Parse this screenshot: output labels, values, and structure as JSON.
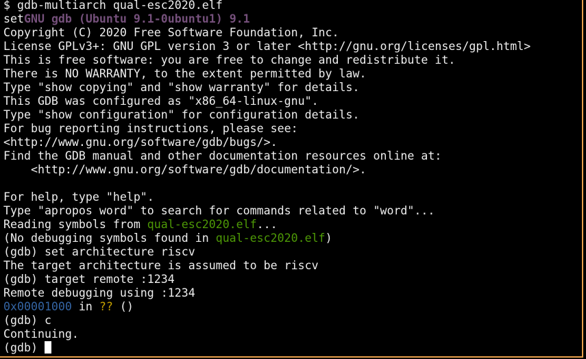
{
  "colors": {
    "background": "#000000",
    "foreground": "#eeeeee",
    "banner": "#75507b",
    "filename": "#4e9a06",
    "address": "#3465a4",
    "unknown_symbol": "#c4a000",
    "window_border": "#e8a04c"
  },
  "terminal": {
    "command_line": "$ gdb-multiarch qual-esc2020.elf",
    "banner_prefix": "set",
    "banner": "GNU gdb (Ubuntu 9.1-0ubuntu1) 9.1",
    "copyright": "Copyright (C) 2020 Free Software Foundation, Inc.",
    "license": "License GPLv3+: GNU GPL version 3 or later <http://gnu.org/licenses/gpl.html>",
    "free_software": "This is free software: you are free to change and redistribute it.",
    "no_warranty": "There is NO WARRANTY, to the extent permitted by law.",
    "show_copying": "Type \"show copying\" and \"show warranty\" for details.",
    "configured": "This GDB was configured as \"x86_64-linux-gnu\".",
    "show_configuration": "Type \"show configuration\" for configuration details.",
    "bug_reporting": "For bug reporting instructions, please see:",
    "bugs_url": "<http://www.gnu.org/software/gdb/bugs/>.",
    "manual": "Find the GDB manual and other documentation resources online at:",
    "documentation_url": "    <http://www.gnu.org/software/gdb/documentation/>.",
    "blank": "",
    "help": "For help, type \"help\".",
    "apropos": "Type \"apropos word\" to search for commands related to \"word\"...",
    "reading_prefix": "Reading symbols from ",
    "reading_file": "qual-esc2020.elf",
    "reading_suffix": "...",
    "no_symbols_prefix": "(No debugging symbols found in ",
    "no_symbols_file": "qual-esc2020.elf",
    "no_symbols_suffix": ")",
    "set_arch_cmd": "(gdb) set architecture riscv",
    "arch_assumed": "The target architecture is assumed to be riscv",
    "target_remote_cmd": "(gdb) target remote :1234",
    "remote_debugging": "Remote debugging using :1234",
    "address": "0x00001000",
    "in_text": " in ",
    "unknown_symbol": "??",
    "frame_args": " ()",
    "continue_cmd": "(gdb) c",
    "continuing": "Continuing.",
    "prompt": "(gdb) "
  }
}
